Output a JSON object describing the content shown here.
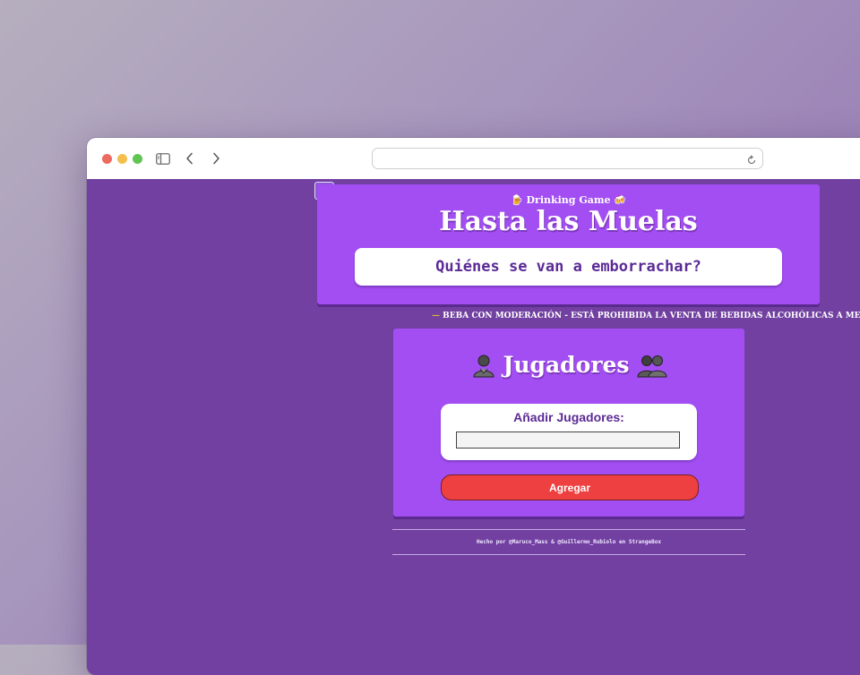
{
  "browser": {
    "url": ""
  },
  "header": {
    "subtitle": "🍺 Drinking Game 🍻",
    "title": "Hasta las Muelas",
    "question": "Quiénes se van a emborrachar?"
  },
  "warning": {
    "dash": "—",
    "text": "BEBA CON MODERACIÓN - ESTÁ PROHIBIDA LA VENTA DE BEBIDAS ALCOHÓLICAS A MENOR"
  },
  "players": {
    "title": "Jugadores",
    "title_icon_left": "person-icon",
    "title_icon_right": "people-icon",
    "add_label": "Añadir Jugadores:",
    "input_value": "",
    "add_button": "Agregar"
  },
  "footer": {
    "text": "Hecho por @Maruco_Mass & @Guillermo_Rubiolo en StrangeBox"
  },
  "colors": {
    "page_bg": "#7140a1",
    "card_bg": "#a24ef2",
    "accent_text": "#5b2a96",
    "button_red": "#ee4040"
  }
}
